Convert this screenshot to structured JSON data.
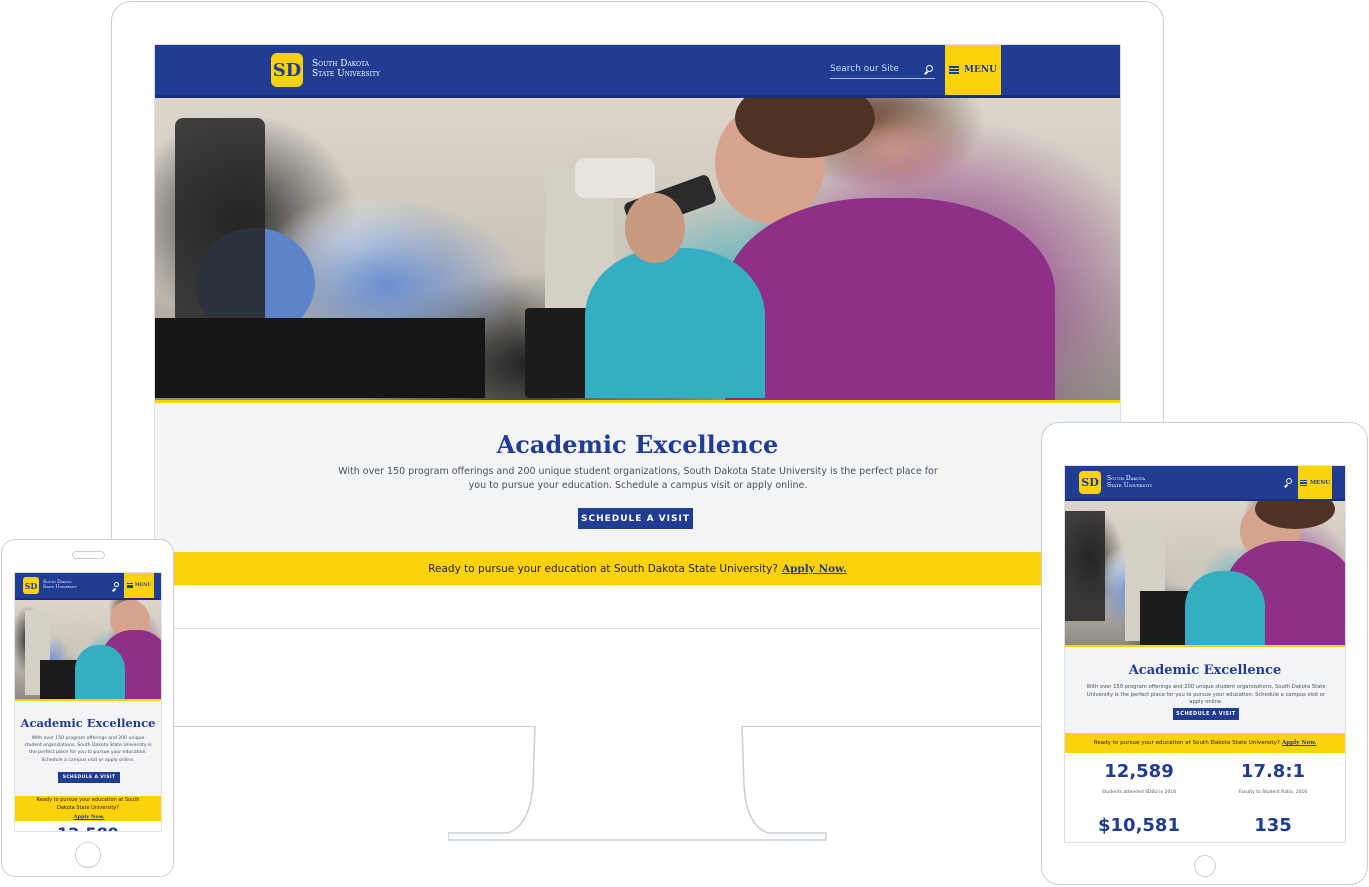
{
  "site": {
    "logo_line1": "South Dakota",
    "logo_line2": "State University",
    "search_placeholder": "Search our Site",
    "menu_label": "MENU"
  },
  "main": {
    "title": "Academic Excellence",
    "description": "With over 150 program offerings and 200 unique student organizations, South Dakota State University is the perfect place for you to pursue your education. Schedule a campus visit or apply online.",
    "cta_label": "SCHEDULE A VISIT",
    "apply_text": "Ready to pursue your education at South Dakota State University?",
    "apply_link": "Apply Now."
  },
  "stats": [
    {
      "value": "12,589",
      "caption": "Students attended SDSU in 2016"
    },
    {
      "value": "17.8:1",
      "caption": "Faculty to Student Ratio, 2016"
    },
    {
      "value": "$10,581",
      "caption": ""
    },
    {
      "value": "135",
      "caption": ""
    }
  ],
  "colors": {
    "brand_blue": "#213c93",
    "brand_yellow": "#fcd20f",
    "frame": "#c9cfd6"
  },
  "icons": {
    "search": "search-icon",
    "menu": "hamburger-icon"
  }
}
